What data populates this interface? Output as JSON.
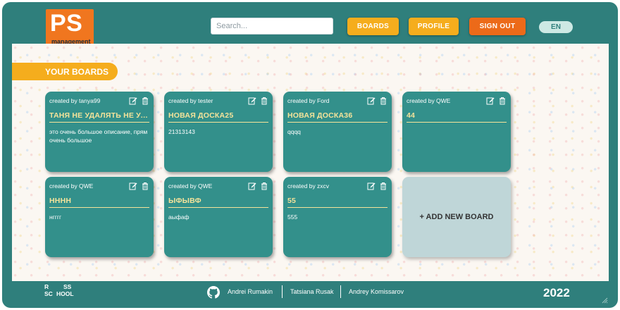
{
  "header": {
    "logo_text": "PS",
    "logo_sub": "management",
    "search_placeholder": "Search...",
    "boards_label": "BOARDS",
    "profile_label": "PROFILE",
    "signout_label": "SIGN OUT",
    "lang_label": "EN"
  },
  "main": {
    "section_label": "YOUR BOARDS",
    "add_board_label": "+ ADD NEW BOARD",
    "boards": [
      {
        "creator": "created by tanya99",
        "title": "ТАНЯ НЕ УДАЛЯТЬ НЕ УД...",
        "description": "это очень большое описание, прям очень большое"
      },
      {
        "creator": "created by tester",
        "title": "НОВАЯ ДОСКА25",
        "description": "21313143"
      },
      {
        "creator": "created by Ford",
        "title": "НОВАЯ ДОСКА36",
        "description": "qqqq"
      },
      {
        "creator": "created by QWE",
        "title": "44",
        "description": ""
      },
      {
        "creator": "created by QWE",
        "title": "НННН",
        "description": "нгггг"
      },
      {
        "creator": "created by QWE",
        "title": "ЫФЫВФ",
        "description": "аыфаф"
      },
      {
        "creator": "created by zxcv",
        "title": "55",
        "description": "555"
      }
    ]
  },
  "footer": {
    "school_logo": [
      "R",
      "SS",
      "SC",
      "HOOL"
    ],
    "authors": [
      "Andrei Rumakin",
      "Tatsiana Rusak",
      "Andrey Komissarov"
    ],
    "year": "2022"
  },
  "icons": {
    "edit": "edit-icon",
    "delete": "trash-icon",
    "github": "github-icon"
  },
  "colors": {
    "primary": "#2f7f7c",
    "card": "#33908b",
    "accent": "#f5ad1d",
    "signout": "#ec6a19",
    "title_text": "#f5e39a"
  }
}
